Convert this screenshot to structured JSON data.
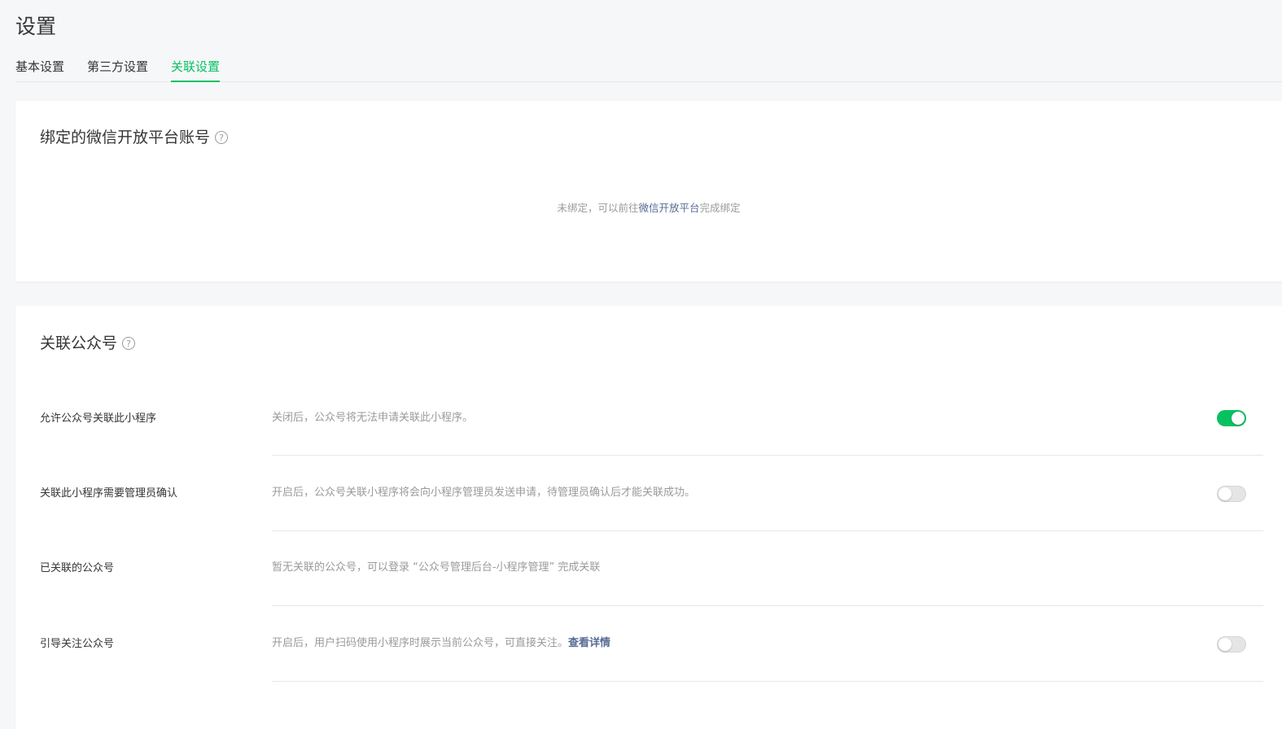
{
  "page": {
    "title": "设置"
  },
  "tabs": [
    {
      "label": "基本设置",
      "active": false
    },
    {
      "label": "第三方设置",
      "active": false
    },
    {
      "label": "关联设置",
      "active": true
    }
  ],
  "bind_card": {
    "title": "绑定的微信开放平台账号",
    "help_icon": "question-circle-icon",
    "empty_prefix": "未绑定，可以前往",
    "empty_link": "微信开放平台",
    "empty_suffix": "完成绑定"
  },
  "relate_card": {
    "title": "关联公众号",
    "help_icon": "question-circle-icon",
    "rows": [
      {
        "label": "允许公众号关联此小程序",
        "desc": "关闭后，公众号将无法申请关联此小程序。",
        "switch": "on"
      },
      {
        "label": "关联此小程序需要管理员确认",
        "desc": "开启后，公众号关联小程序将会向小程序管理员发送申请，待管理员确认后才能关联成功。",
        "switch": "off"
      },
      {
        "label": "已关联的公众号",
        "desc": "暂无关联的公众号，可以登录 “公众号管理后台-小程序管理” 完成关联"
      },
      {
        "label": "引导关注公众号",
        "desc": "开启后，用户扫码使用小程序时展示当前公众号，可直接关注。",
        "desc_link": "查看详情",
        "switch": "off"
      }
    ]
  },
  "colors": {
    "accent": "#07c160",
    "link": "#576b95",
    "muted_text": "#9a9a9a",
    "page_bg": "#f6f7f9"
  }
}
